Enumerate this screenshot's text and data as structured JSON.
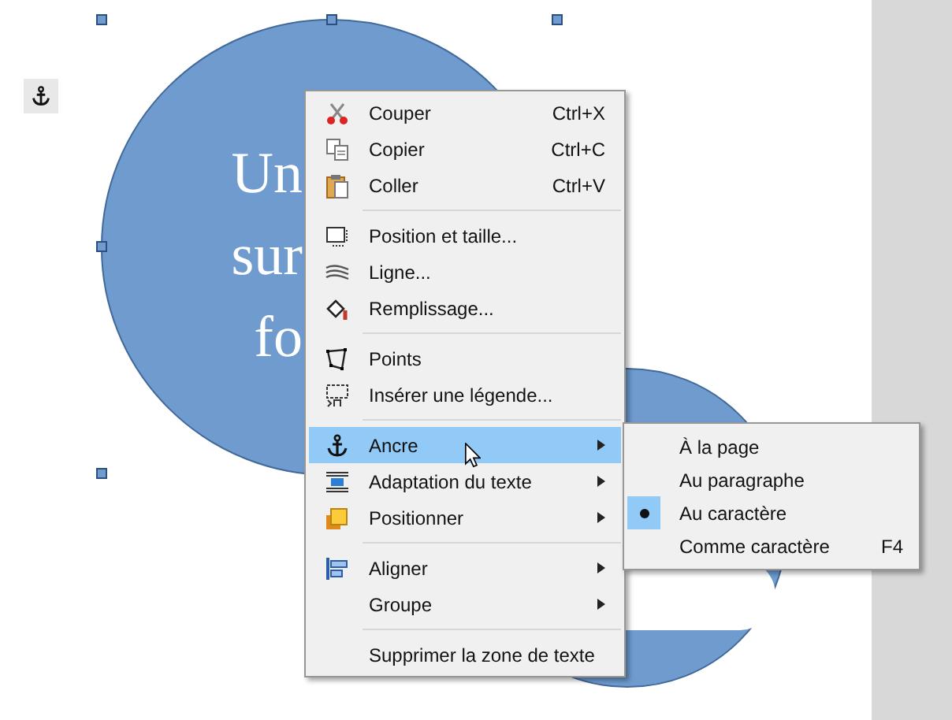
{
  "shape_text": [
    "Un",
    "sur",
    "fo"
  ],
  "context_menu": {
    "groups": [
      [
        {
          "kind": "command",
          "label": "Couper",
          "shortcut": "Ctrl+X",
          "selected": false
        },
        {
          "kind": "command",
          "label": "Copier",
          "shortcut": "Ctrl+C",
          "selected": false
        },
        {
          "kind": "command",
          "label": "Coller",
          "shortcut": "Ctrl+V",
          "selected": false
        }
      ],
      [
        {
          "kind": "command",
          "label": "Position et taille...",
          "selected": false
        },
        {
          "kind": "command",
          "label": "Ligne...",
          "selected": false
        },
        {
          "kind": "command",
          "label": "Remplissage...",
          "selected": false
        }
      ],
      [
        {
          "kind": "command",
          "label": "Points",
          "selected": false
        },
        {
          "kind": "command",
          "label": "Insérer une légende...",
          "selected": false
        }
      ],
      [
        {
          "kind": "submenu",
          "label": "Ancre",
          "selected": true
        },
        {
          "kind": "submenu",
          "label": "Adaptation du texte",
          "selected": false
        },
        {
          "kind": "submenu",
          "label": "Positionner",
          "selected": false
        }
      ],
      [
        {
          "kind": "submenu",
          "label": "Aligner",
          "selected": false
        },
        {
          "kind": "submenu",
          "label": "Groupe",
          "selected": false
        }
      ],
      [
        {
          "kind": "command",
          "label": "Supprimer la zone de texte",
          "selected": false
        }
      ]
    ]
  },
  "submenu": [
    {
      "label": "À la page",
      "selected": false
    },
    {
      "label": "Au paragraphe",
      "selected": false
    },
    {
      "label": "Au caractère",
      "selected": true
    },
    {
      "label": "Comme caractère",
      "shortcut": "F4",
      "selected": false
    }
  ]
}
